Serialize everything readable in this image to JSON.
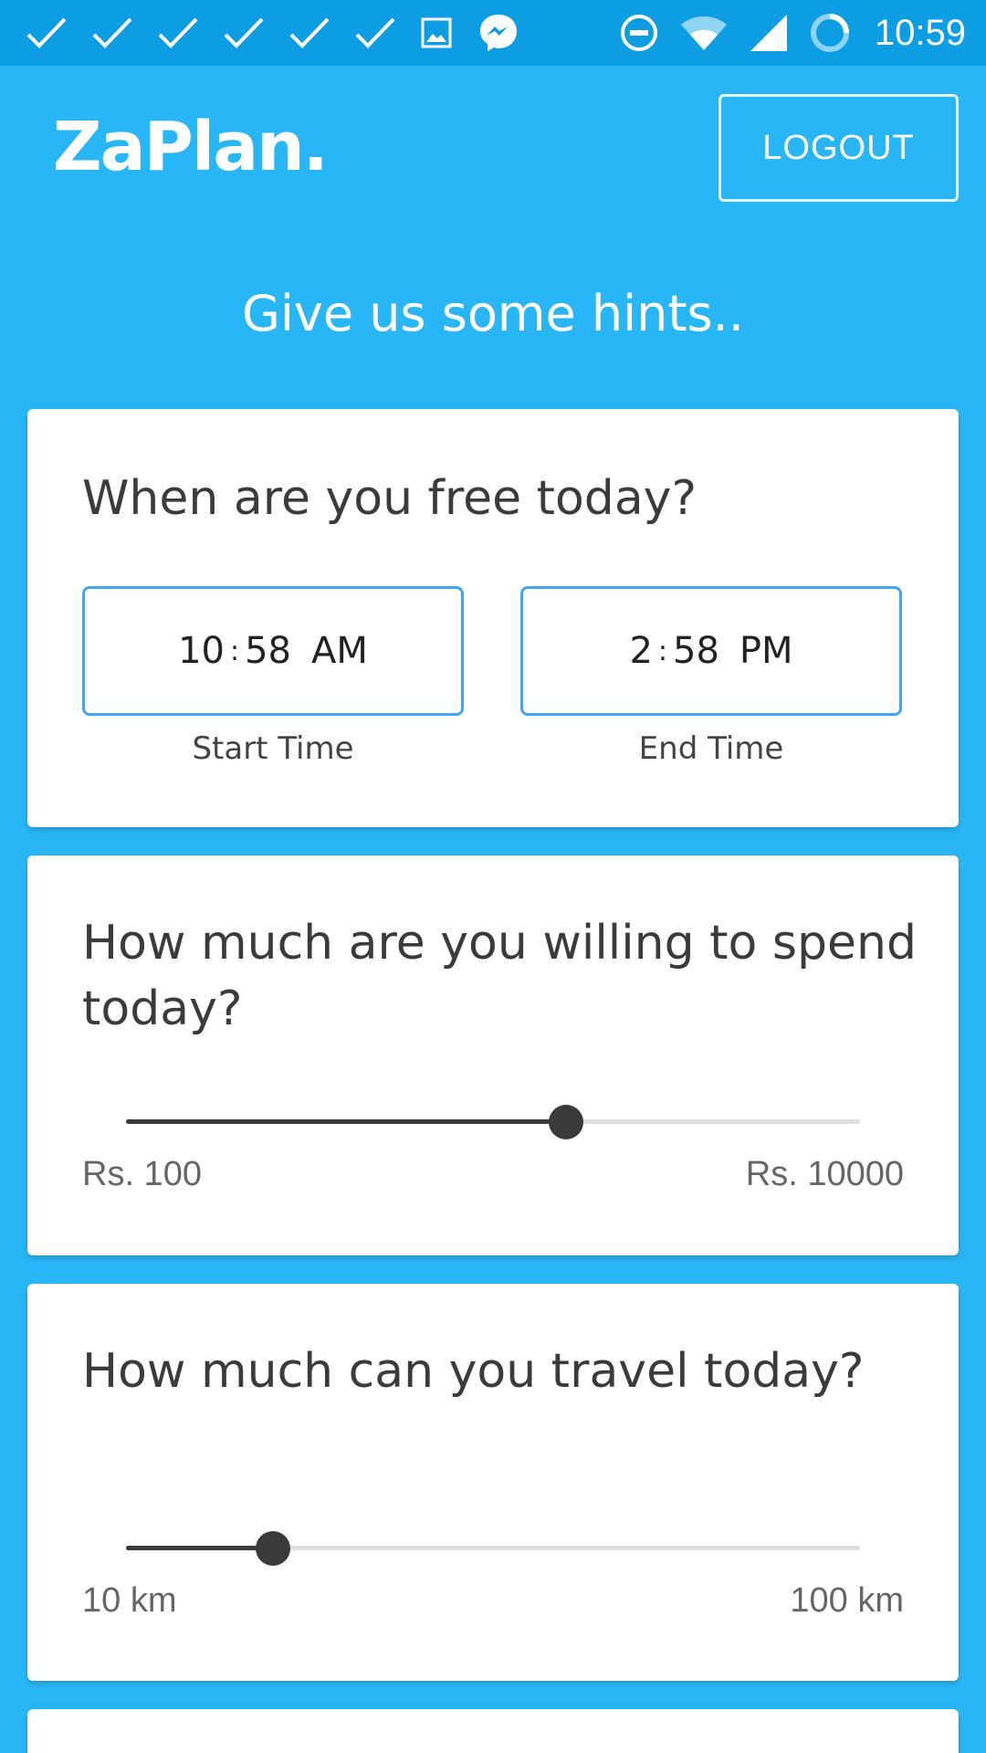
{
  "status_bar": {
    "time": "10:59",
    "left_icons": [
      "check-icon",
      "check-icon",
      "check-icon",
      "check-icon",
      "check-icon",
      "check-icon",
      "image-icon",
      "messenger-icon"
    ],
    "right_icons": [
      "do-not-disturb-icon",
      "wifi-icon",
      "cell-signal-icon",
      "sync-icon"
    ]
  },
  "header": {
    "brand": "ZaPlan.",
    "logout_label": "LOGOUT"
  },
  "hint_title": "Give us some hints..",
  "free_time": {
    "question": "When are you free today?",
    "start": {
      "hour": "10",
      "minute": "58",
      "period": "AM",
      "label": "Start Time"
    },
    "end": {
      "hour": "2",
      "minute": "58",
      "period": "PM",
      "label": "End Time"
    }
  },
  "budget": {
    "question": "How much are you willing to spend today?",
    "min_label": "Rs. 100",
    "max_label": "Rs. 10000",
    "position_fraction": 0.6
  },
  "travel": {
    "question": "How much can you travel today?",
    "min_label": "10 km",
    "max_label": "100 km",
    "position_fraction": 0.2
  },
  "colors": {
    "background": "#29b6f6",
    "status_bar": "#0d9de3",
    "accent_border": "#42a5f5",
    "slider_active": "#3a3a3a",
    "slider_rail": "#dedede"
  }
}
